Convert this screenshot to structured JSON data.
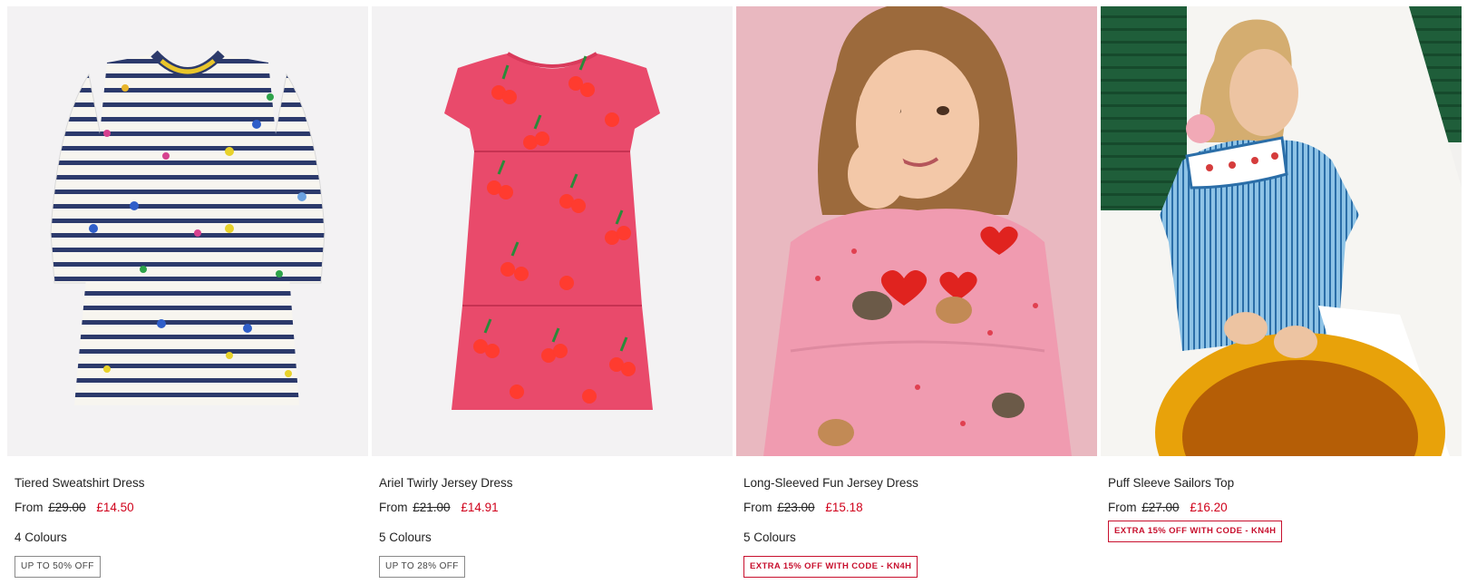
{
  "products": [
    {
      "title": "Tiered Sweatshirt Dress",
      "from_label": "From",
      "was_price": "£29.00",
      "now_price": "£14.50",
      "colours": "4 Colours",
      "badge": "UP TO 50% OFF",
      "image": "striped-tiered-dress"
    },
    {
      "title": "Ariel Twirly Jersey Dress",
      "from_label": "From",
      "was_price": "£21.00",
      "now_price": "£14.91",
      "colours": "5 Colours",
      "badge": "UP TO 28% OFF",
      "image": "cherry-print-dress"
    },
    {
      "title": "Long-Sleeved Fun Jersey Dress",
      "from_label": "From",
      "was_price": "£23.00",
      "now_price": "£15.18",
      "colours": "5 Colours",
      "badge": "EXTRA 15% OFF WITH CODE - KN4H",
      "image": "girl-pink-dress-peace-sign"
    },
    {
      "title": "Puff Sleeve Sailors Top",
      "from_label": "From",
      "was_price": "£27.00",
      "now_price": "£16.20",
      "colours": "",
      "badge": "EXTRA 15% OFF WITH CODE - KN4H",
      "image": "girl-blue-striped-top"
    }
  ],
  "colors": {
    "sale_price": "#d0021b",
    "promo_badge": "#c8102e",
    "image_bg": "#f3f2f3"
  }
}
